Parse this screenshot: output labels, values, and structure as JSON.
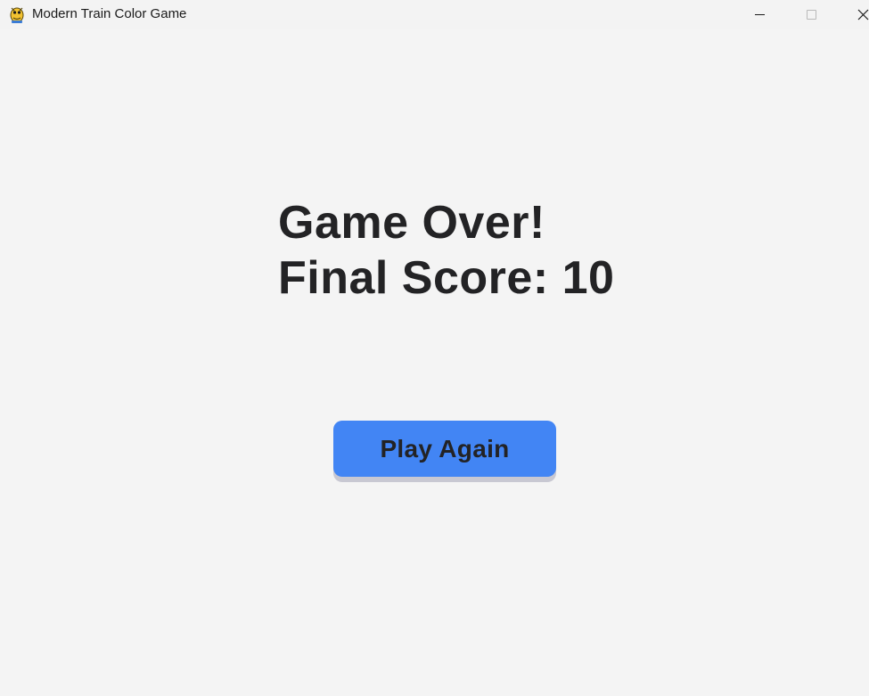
{
  "window": {
    "title": "Modern Train Color Game",
    "app_icon": "pygame-snake-icon",
    "controls": {
      "minimize": "minimize-icon",
      "maximize": "maximize-icon",
      "close": "close-icon"
    }
  },
  "game_over": {
    "heading": "Game Over!",
    "score_line": "Final Score: 10",
    "play_again_label": "Play Again"
  },
  "colors": {
    "background": "#f4f4f4",
    "text": "#232325",
    "button": "#4285f4",
    "button_shadow": "#c8c8d2"
  }
}
